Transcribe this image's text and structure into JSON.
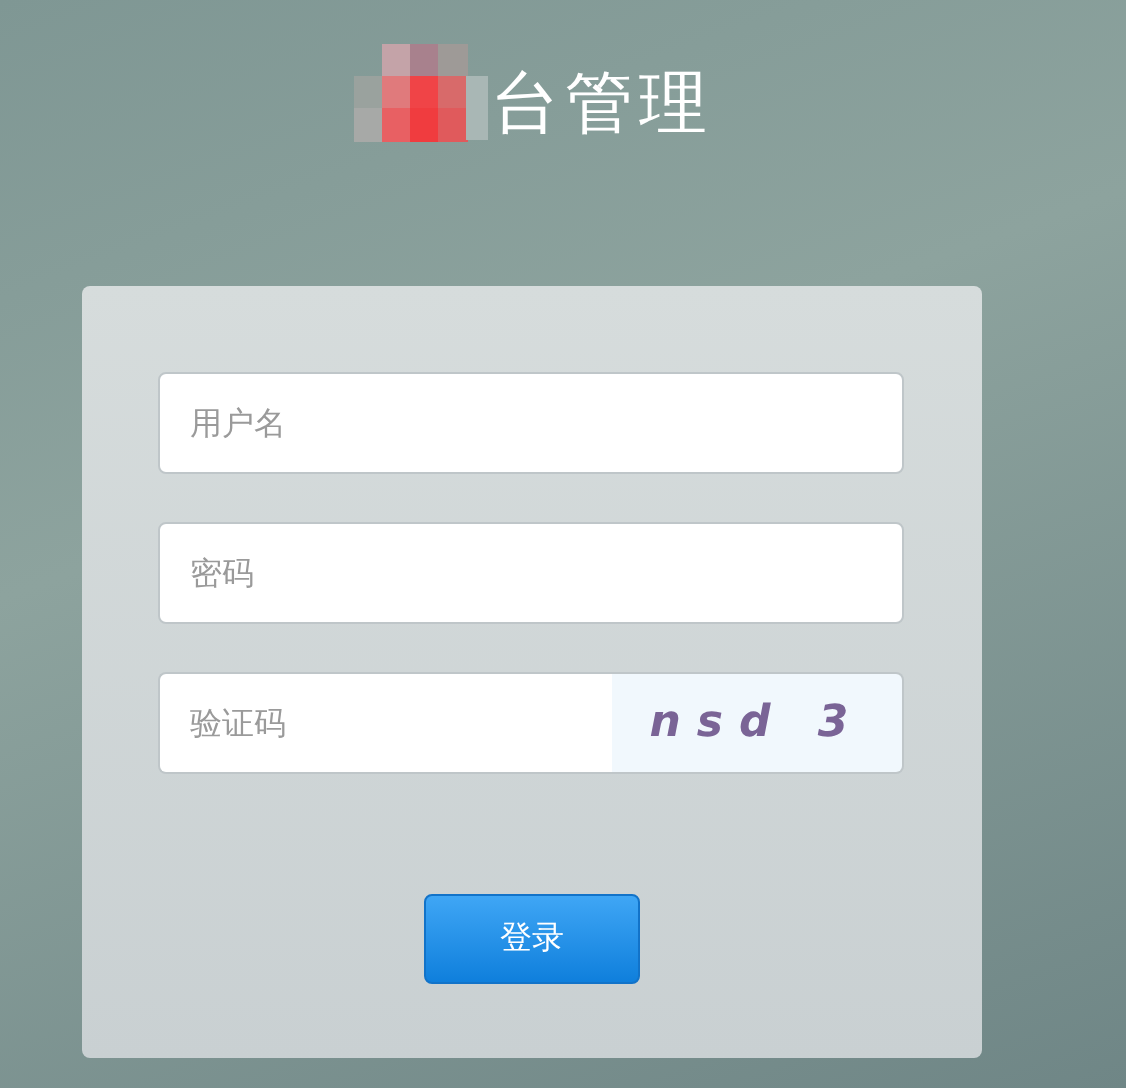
{
  "header": {
    "title": "台管理"
  },
  "form": {
    "username": {
      "placeholder": "用户名"
    },
    "password": {
      "placeholder": "密码"
    },
    "captcha_field": {
      "placeholder": "验证码"
    },
    "captcha": "nsd 3",
    "submit": "登录"
  }
}
